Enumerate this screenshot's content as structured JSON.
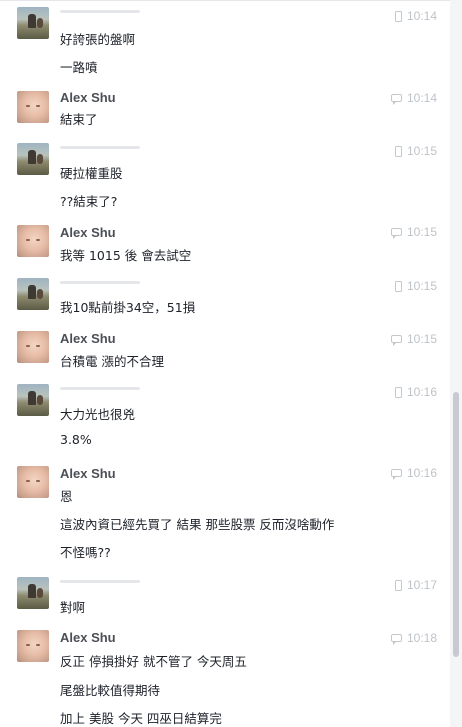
{
  "thread": {
    "groups": [
      {
        "sender": "",
        "avatar": "landscape-photo",
        "device": "phone",
        "time": "10:14",
        "messages": [
          "好誇張的盤啊",
          "一路噴"
        ]
      },
      {
        "sender": "Alex Shu",
        "avatar": "baby-photo",
        "device": "chat",
        "time": "10:14",
        "messages": [
          "結束了"
        ]
      },
      {
        "sender": "",
        "avatar": "landscape-photo",
        "device": "phone",
        "time": "10:15",
        "messages": [
          "硬拉權重股",
          "??結束了?"
        ]
      },
      {
        "sender": "Alex Shu",
        "avatar": "baby-photo",
        "device": "chat",
        "time": "10:15",
        "messages": [
          "我等 1015 後 會去試空"
        ]
      },
      {
        "sender": "",
        "avatar": "landscape-photo",
        "device": "phone",
        "time": "10:15",
        "messages": [
          "我10點前掛34空，51損"
        ]
      },
      {
        "sender": "Alex Shu",
        "avatar": "baby-photo",
        "device": "chat",
        "time": "10:15",
        "messages": [
          "台積電 漲的不合理"
        ]
      },
      {
        "sender": "",
        "avatar": "landscape-photo",
        "device": "phone",
        "time": "10:16",
        "messages": [
          "大力光也很兇",
          "3.8%"
        ]
      },
      {
        "sender": "Alex Shu",
        "avatar": "baby-photo",
        "device": "chat",
        "time": "10:16",
        "messages": [
          "恩",
          "這波內資已經先買了 結果 那些股票 反而沒啥動作",
          "不怪嗎??"
        ]
      },
      {
        "sender": "",
        "avatar": "landscape-photo",
        "device": "phone",
        "time": "10:17",
        "messages": [
          "對啊"
        ]
      },
      {
        "sender": "Alex Shu",
        "avatar": "baby-photo",
        "device": "chat",
        "time": "10:18",
        "messages": [
          "反正 停損掛好 就不管了 今天周五",
          "尾盤比較值得期待",
          "加上 美股 今天 四巫日結算完"
        ]
      }
    ]
  },
  "icons": {
    "phone": "mobile-phone-icon",
    "chat": "chat-bubble-icon"
  },
  "colors": {
    "name": "#4b4f56",
    "text": "#1d2129",
    "time": "#bec3c9"
  }
}
